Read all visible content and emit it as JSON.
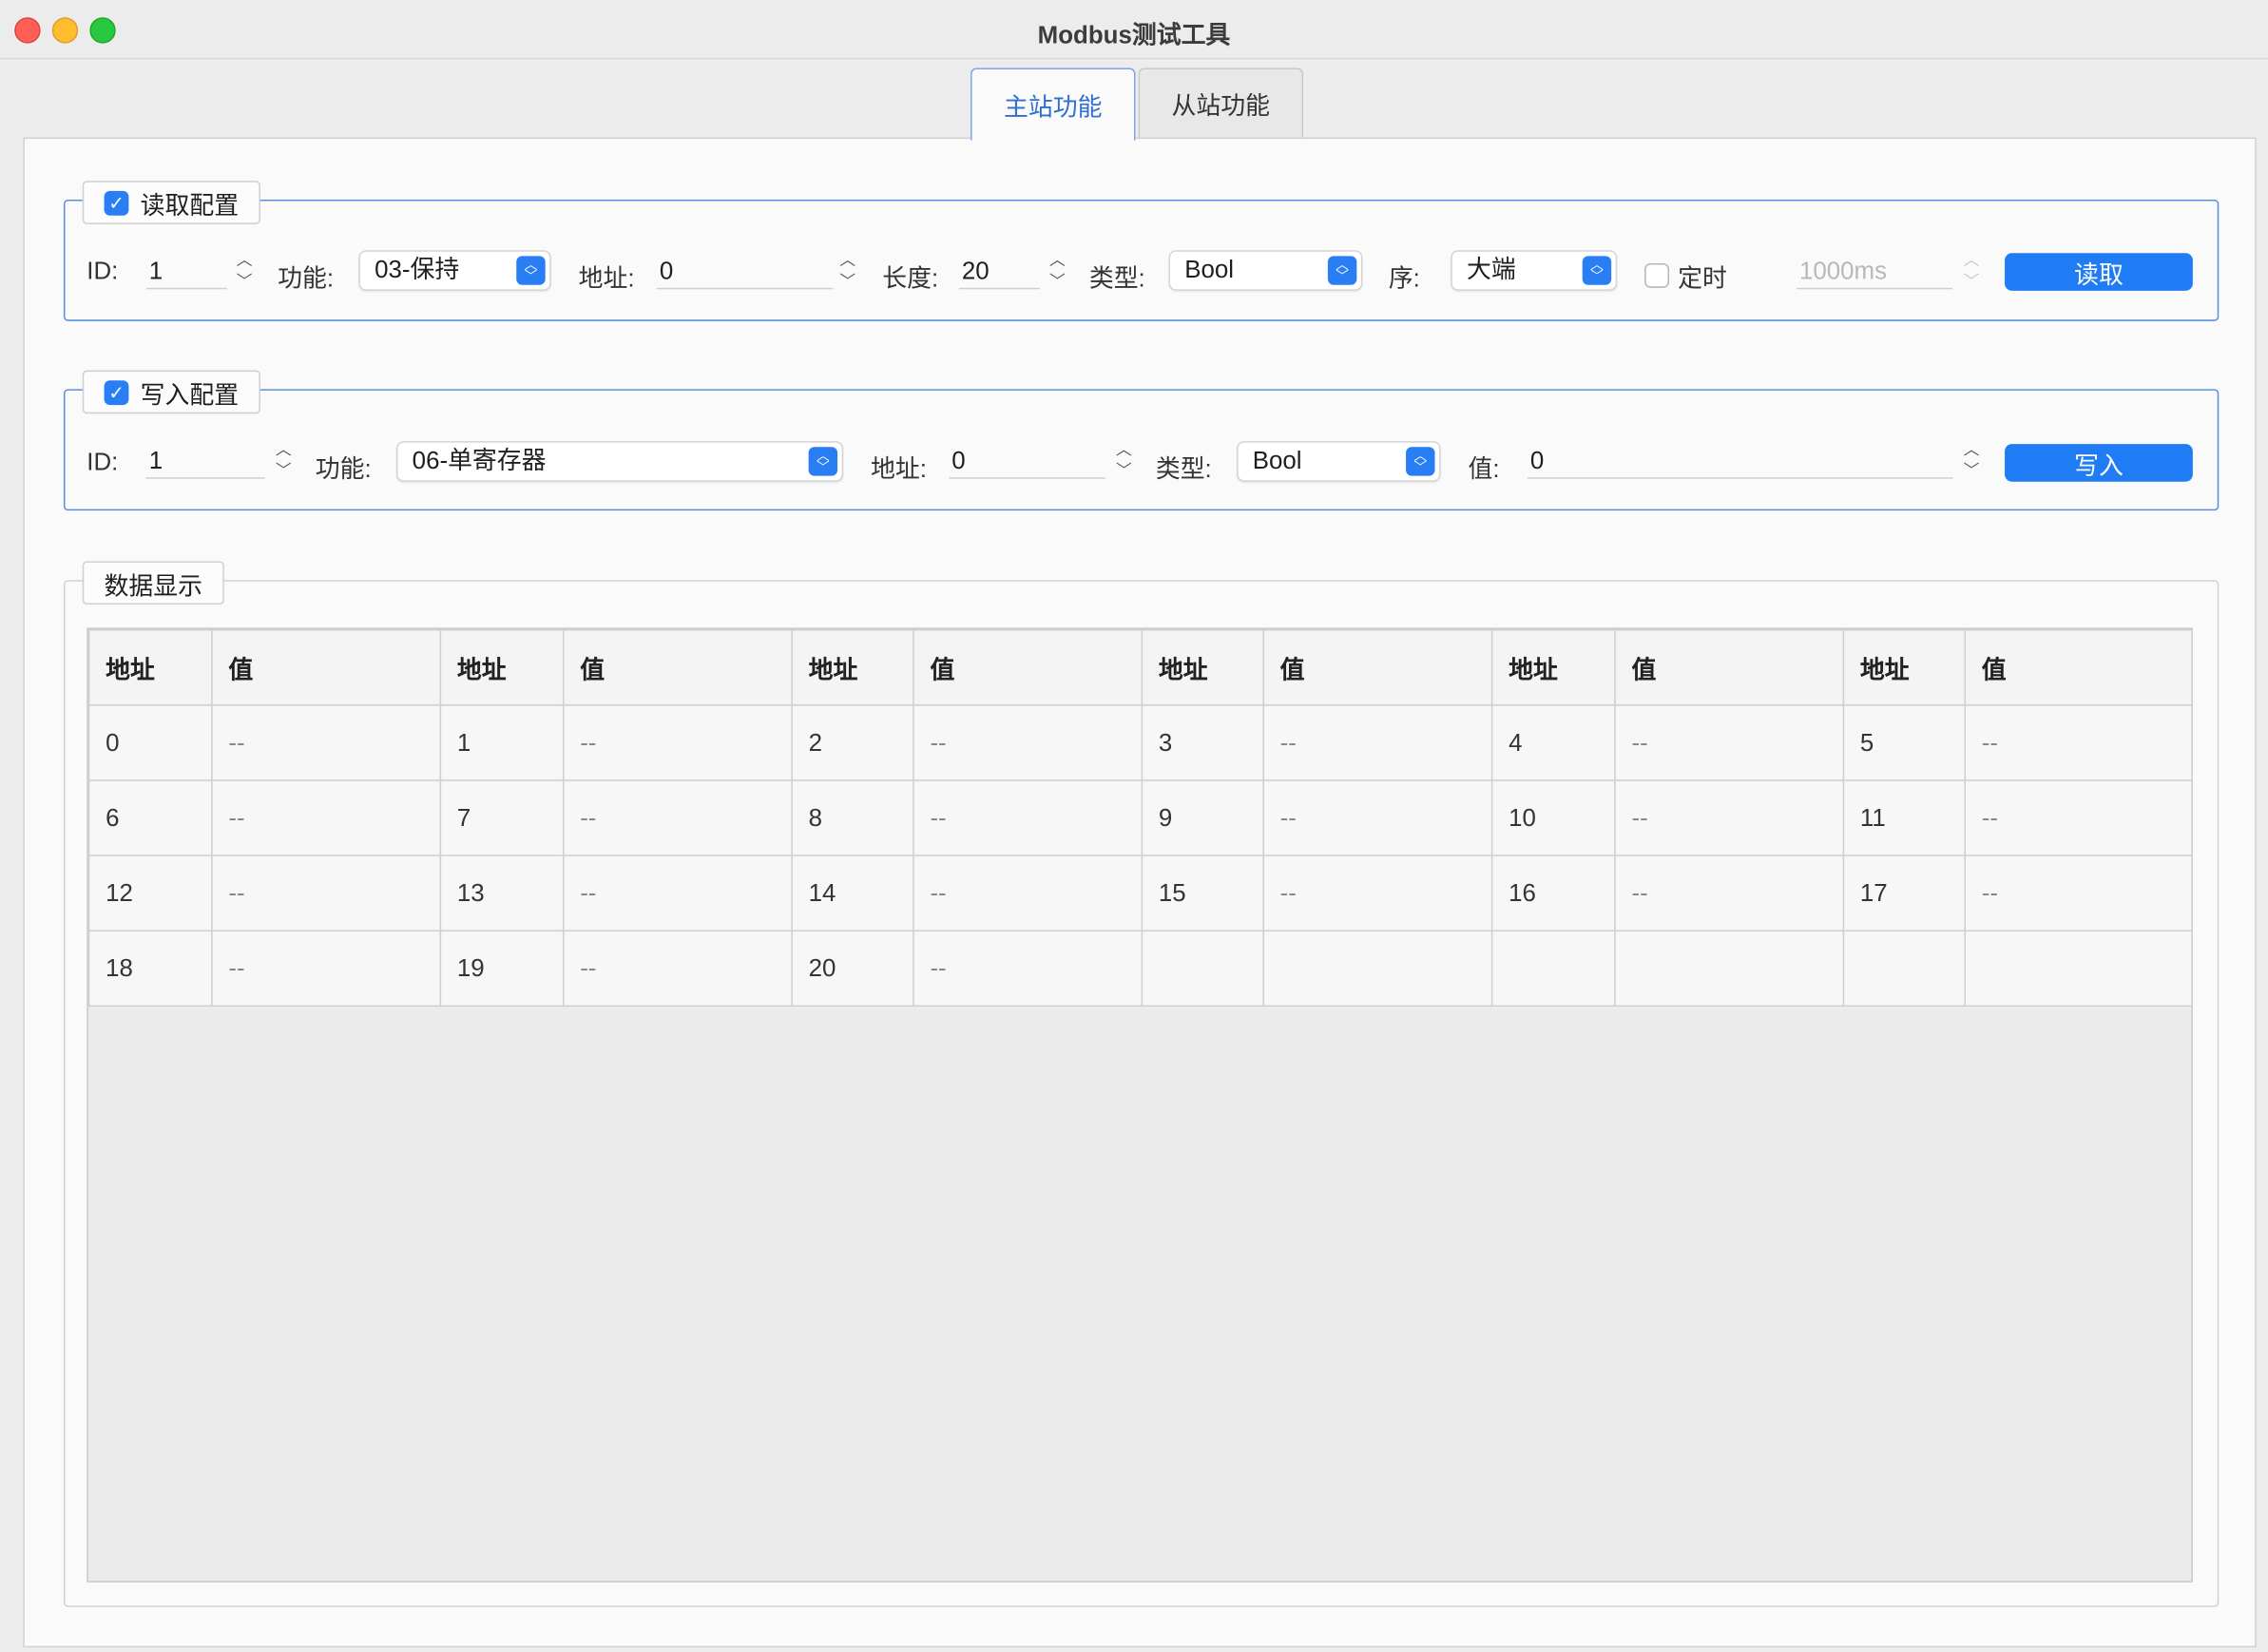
{
  "window": {
    "title": "Modbus测试工具"
  },
  "tabs": [
    {
      "label": "主站功能",
      "active": true
    },
    {
      "label": "从站功能",
      "active": false
    }
  ],
  "read_config": {
    "title": "读取配置",
    "enabled": true,
    "id_label": "ID:",
    "id_value": "1",
    "function_label": "功能:",
    "function_value": "03-保持",
    "address_label": "地址:",
    "address_value": "0",
    "length_label": "长度:",
    "length_value": "20",
    "type_label": "类型:",
    "type_value": "Bool",
    "order_label": "序:",
    "order_value": "大端",
    "timer_label": "定时",
    "timer_checked": false,
    "interval_value": "1000ms",
    "read_button": "读取"
  },
  "write_config": {
    "title": "写入配置",
    "enabled": true,
    "id_label": "ID:",
    "id_value": "1",
    "function_label": "功能:",
    "function_value": "06-单寄存器",
    "address_label": "地址:",
    "address_value": "0",
    "type_label": "类型:",
    "type_value": "Bool",
    "value_label": "值:",
    "value_value": "0",
    "write_button": "写入"
  },
  "data_display": {
    "title": "数据显示",
    "headers": [
      "地址",
      "值",
      "地址",
      "值",
      "地址",
      "值",
      "地址",
      "值",
      "地址",
      "值",
      "地址",
      "值"
    ],
    "rows": [
      [
        "0",
        "--",
        "1",
        "--",
        "2",
        "--",
        "3",
        "--",
        "4",
        "--",
        "5",
        "--"
      ],
      [
        "6",
        "--",
        "7",
        "--",
        "8",
        "--",
        "9",
        "--",
        "10",
        "--",
        "11",
        "--"
      ],
      [
        "12",
        "--",
        "13",
        "--",
        "14",
        "--",
        "15",
        "--",
        "16",
        "--",
        "17",
        "--"
      ],
      [
        "18",
        "--",
        "19",
        "--",
        "20",
        "--",
        "",
        "",
        "",
        "",
        "",
        ""
      ]
    ]
  },
  "colors": {
    "accent": "#1f7cf5",
    "group_border": "#5b8fdc",
    "tab_active_text": "#2f6fd1"
  }
}
